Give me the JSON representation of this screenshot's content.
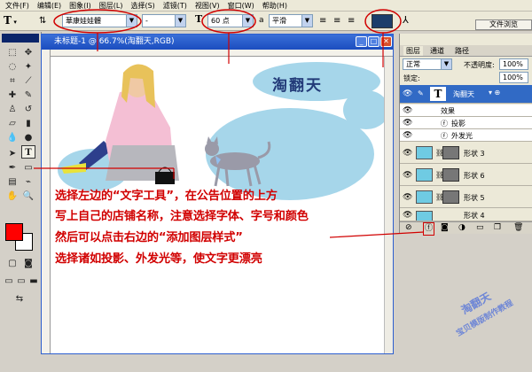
{
  "menu": [
    "文件(F)",
    "编辑(E)",
    "图象(I)",
    "图层(L)",
    "选择(S)",
    "滤镜(T)",
    "视图(V)",
    "窗口(W)",
    "帮助(H)"
  ],
  "options": {
    "tool_icon": "T",
    "font_family": "華康娃娃體",
    "font_style": "-",
    "size_glyph": "T",
    "font_size": "60 点",
    "aa_label": "a",
    "aa_value": "平滑",
    "text_color": "#1c3d6b",
    "file_browser": "文件浏览"
  },
  "document": {
    "title": "未标题-1 @ 66.7%(淘翻天,RGB)",
    "headline": "淘翻天",
    "headline_color": "#223a78",
    "ellipse_color": "#a6d6ea"
  },
  "panel": {
    "tabs": [
      "图层",
      "通道",
      "路径"
    ],
    "blend_mode": "正常",
    "opacity_label": "不透明度:",
    "opacity_value": "100%",
    "lock_label": "锁定:",
    "fill_value": "100%",
    "layers": [
      {
        "name": "淘翻天",
        "type": "text",
        "selected": true
      },
      {
        "name": "效果",
        "type": "effects-header"
      },
      {
        "name": "投影",
        "type": "effect"
      },
      {
        "name": "外发光",
        "type": "effect"
      },
      {
        "name": "形状 3",
        "type": "shape"
      },
      {
        "name": "形状 6",
        "type": "shape"
      },
      {
        "name": "形状 5",
        "type": "shape"
      },
      {
        "name": "形状 4",
        "type": "shape"
      }
    ]
  },
  "instructions": [
    "选择左边的“文字工具”，在公告位置的上方",
    "写上自己的店铺名称，注意选择字体、字号和颜色",
    "然后可以点击右边的“添加图层样式”",
    "选择诸如投影、外发光等，使文字更漂亮"
  ],
  "watermark": {
    "line1": "淘翻天",
    "line2": "宝贝模版制作教程"
  },
  "colors": {
    "annotation": "#d10000",
    "foreground": "#ff0000",
    "background": "#ffffff"
  }
}
